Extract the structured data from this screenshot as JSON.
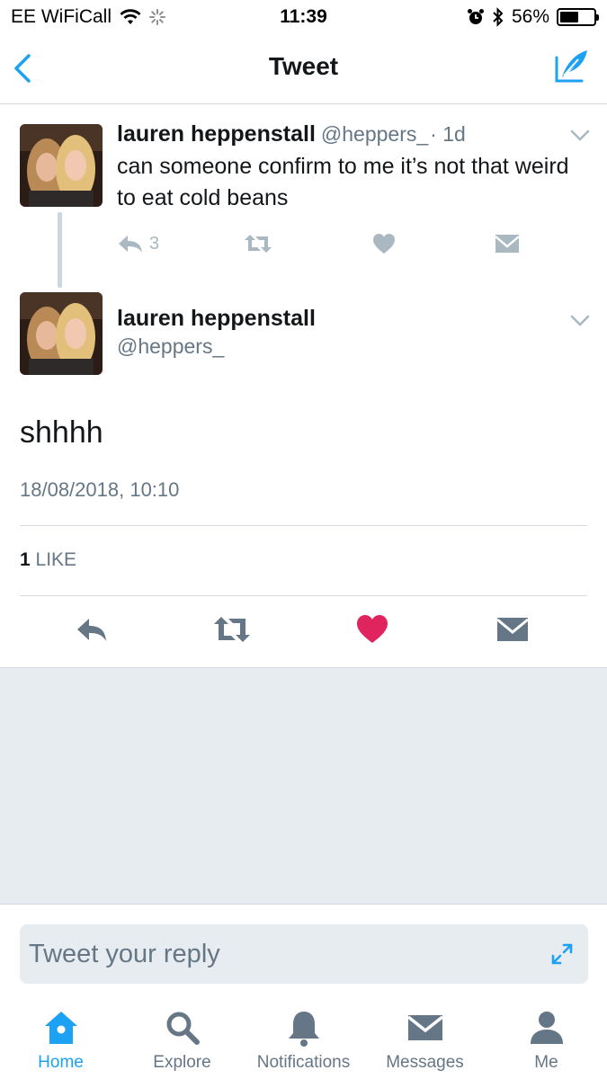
{
  "status_bar": {
    "carrier": "EE WiFiCall",
    "time": "11:39",
    "battery": "56%",
    "battery_level": 0.56
  },
  "nav": {
    "title": "Tweet"
  },
  "parent_tweet": {
    "name": "lauren heppenstall",
    "handle": "@heppers_",
    "time": "· 1d",
    "text": "can someone confirm to me it’s not that weird to eat cold beans",
    "reply_count": "3"
  },
  "main_tweet": {
    "name": "lauren heppenstall",
    "handle": "@heppers_",
    "text": "shhhh",
    "timestamp": "18/08/2018, 10:10",
    "like_count": "1",
    "like_label": "LIKE",
    "liked": true
  },
  "reply": {
    "placeholder": "Tweet your reply"
  },
  "tabs": [
    {
      "label": "Home",
      "icon": "home-icon",
      "active": true
    },
    {
      "label": "Explore",
      "icon": "search-icon",
      "active": false
    },
    {
      "label": "Notifications",
      "icon": "bell-icon",
      "active": false
    },
    {
      "label": "Messages",
      "icon": "envelope-icon",
      "active": false
    },
    {
      "label": "Me",
      "icon": "person-icon",
      "active": false
    }
  ],
  "colors": {
    "accent": "#1da1f2",
    "like": "#e0245e",
    "muted": "#657786",
    "action_gray": "#aab8c2",
    "background_gray": "#e6ecf0"
  }
}
